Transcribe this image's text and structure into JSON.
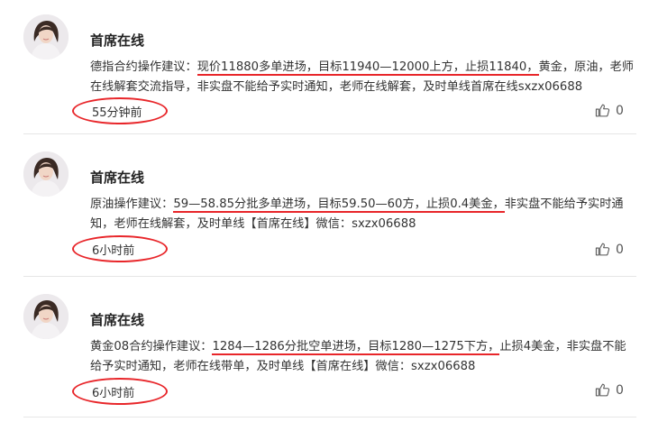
{
  "posts": [
    {
      "author": "首席在线",
      "segments": [
        {
          "text": "德指合约操作建议：",
          "u": false
        },
        {
          "text": "现价11880多单进场，目标11940—12000上方，止损11840，",
          "u": true
        },
        {
          "text": "黄金，原油，老师在线解套交流指导，非实盘不能给予实时通知，老师在线解套，及时单线首席在线sxzx06688",
          "u": false
        }
      ],
      "time": "55分钟前",
      "likes": "0"
    },
    {
      "author": "首席在线",
      "segments": [
        {
          "text": "原油操作建议：",
          "u": false
        },
        {
          "text": "59—58.85分批多单进场，目标59.50—60方，止损0.4美金，",
          "u": true
        },
        {
          "text": "非实盘不能给予实时通知，老师在线解套，及时单线【首席在线】微信：sxzx06688",
          "u": false
        }
      ],
      "time": "6小时前",
      "likes": "0"
    },
    {
      "author": "首席在线",
      "segments": [
        {
          "text": "黄金08合约操作建议：",
          "u": false
        },
        {
          "text": "1284—1286分批空单进场，目标1280—1275下方，",
          "u": true
        },
        {
          "text": "止损4美金，非实盘不能给予实时通知，老师在线带单，及时单线【首席在线】微信：sxzx06688",
          "u": false
        }
      ],
      "time": "6小时前",
      "likes": "0"
    }
  ],
  "colors": {
    "annotation": "#e8262a",
    "divider": "#e6e6e6"
  },
  "icons": {
    "like": "thumbs-up-icon",
    "avatar": "author-avatar"
  }
}
